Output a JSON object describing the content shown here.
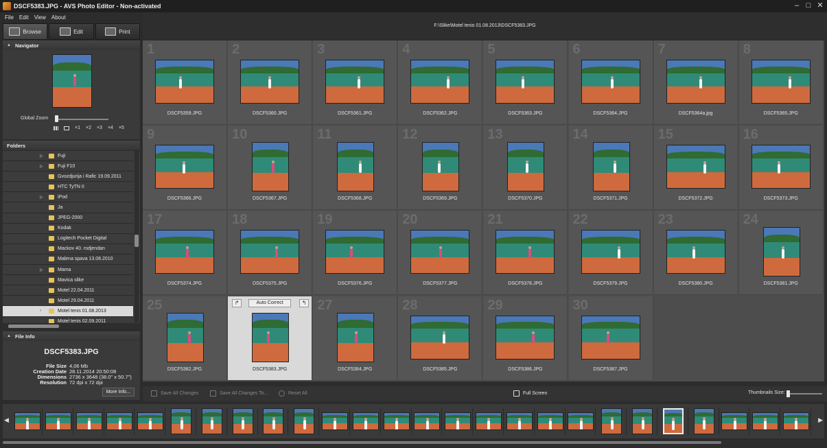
{
  "window": {
    "title": "DSCF5383.JPG - AVS Photo Editor - Non-activated",
    "controls": [
      "minimize-icon",
      "maximize-icon",
      "close-icon"
    ]
  },
  "menu": [
    "File",
    "Edit",
    "View",
    "About"
  ],
  "mode_tabs": [
    {
      "label": "Browse",
      "icon": "browse-icon",
      "active": true
    },
    {
      "label": "Edit",
      "icon": "edit-icon",
      "active": false
    },
    {
      "label": "Print",
      "icon": "print-icon",
      "active": false
    }
  ],
  "navigator": {
    "title": "Navigator",
    "zoom_label": "Global Zoom",
    "zoom_levels": [
      "×1",
      "×2",
      "×3",
      "×4",
      "×5"
    ]
  },
  "folders": {
    "title": "Folders",
    "items": [
      {
        "label": "Fuji",
        "expandable": true,
        "selected": false
      },
      {
        "label": "Fuji F10",
        "expandable": true,
        "selected": false
      },
      {
        "label": "Gvozdjurija i Rafic 19.09.2011",
        "expandable": false,
        "selected": false
      },
      {
        "label": "HTC TyTN II",
        "expandable": false,
        "selected": false
      },
      {
        "label": "iPod",
        "expandable": true,
        "selected": false
      },
      {
        "label": "Ja",
        "expandable": false,
        "selected": false
      },
      {
        "label": "JPEG-2000",
        "expandable": false,
        "selected": false
      },
      {
        "label": "Kodak",
        "expandable": false,
        "selected": false
      },
      {
        "label": "Logitech Pocket Digital",
        "expandable": false,
        "selected": false
      },
      {
        "label": "Mackov 40. rodjendan",
        "expandable": false,
        "selected": false
      },
      {
        "label": "Malena spava 13.08.2010",
        "expandable": false,
        "selected": false
      },
      {
        "label": "Mama",
        "expandable": true,
        "selected": false
      },
      {
        "label": "Mavica slike",
        "expandable": false,
        "selected": false
      },
      {
        "label": "Motel 22.04.2011",
        "expandable": false,
        "selected": false
      },
      {
        "label": "Motel 29.04.2011",
        "expandable": false,
        "selected": false
      },
      {
        "label": "Motel tenis 01.08.2013",
        "expandable": true,
        "selected": true
      },
      {
        "label": "Motel tenis 02.09.2011",
        "expandable": false,
        "selected": false
      }
    ]
  },
  "file_info": {
    "title": "File Info",
    "name": "DSCF5383.JPG",
    "rows": [
      {
        "key": "File Size",
        "value": "4,06 Mb"
      },
      {
        "key": "Creation Date",
        "value": "28.11.2014  20:50:08"
      },
      {
        "key": "Dimensions",
        "value": "2736 x 3648 (38.0\" x 50.7\")"
      },
      {
        "key": "Resolution",
        "value": "72 dpi x 72 dpi"
      }
    ],
    "more_button": "More Info..."
  },
  "path": "F:\\Slike\\Motel tenis 01.08.2013\\DSCF5383.JPG",
  "thumbnails": [
    {
      "n": "1",
      "name": "DSCF5359.JPG",
      "portrait": false
    },
    {
      "n": "2",
      "name": "DSCF5360.JPG",
      "portrait": false
    },
    {
      "n": "3",
      "name": "DSCF5361.JPG",
      "portrait": false
    },
    {
      "n": "4",
      "name": "DSCF5362.JPG",
      "portrait": false
    },
    {
      "n": "5",
      "name": "DSCF5363.JPG",
      "portrait": false
    },
    {
      "n": "6",
      "name": "DSCF5364.JPG",
      "portrait": false
    },
    {
      "n": "7",
      "name": "DSCF5364a.jpg",
      "portrait": false
    },
    {
      "n": "8",
      "name": "DSCF5365.JPG",
      "portrait": false
    },
    {
      "n": "9",
      "name": "DSCF5366.JPG",
      "portrait": false
    },
    {
      "n": "10",
      "name": "DSCF5367.JPG",
      "portrait": true
    },
    {
      "n": "11",
      "name": "DSCF5368.JPG",
      "portrait": true
    },
    {
      "n": "12",
      "name": "DSCF5369.JPG",
      "portrait": true
    },
    {
      "n": "13",
      "name": "DSCF5370.JPG",
      "portrait": true
    },
    {
      "n": "14",
      "name": "DSCF5371.JPG",
      "portrait": true
    },
    {
      "n": "15",
      "name": "DSCF5372.JPG",
      "portrait": false
    },
    {
      "n": "16",
      "name": "DSCF5373.JPG",
      "portrait": false
    },
    {
      "n": "17",
      "name": "DSCF5374.JPG",
      "portrait": false
    },
    {
      "n": "18",
      "name": "DSCF5375.JPG",
      "portrait": false
    },
    {
      "n": "19",
      "name": "DSCF5376.JPG",
      "portrait": false
    },
    {
      "n": "20",
      "name": "DSCF5377.JPG",
      "portrait": false
    },
    {
      "n": "21",
      "name": "DSCF5378.JPG",
      "portrait": false
    },
    {
      "n": "22",
      "name": "DSCF5379.JPG",
      "portrait": false
    },
    {
      "n": "23",
      "name": "DSCF5380.JPG",
      "portrait": false
    },
    {
      "n": "24",
      "name": "DSCF5381.JPG",
      "portrait": true
    },
    {
      "n": "25",
      "name": "DSCF5382.JPG",
      "portrait": true
    },
    {
      "n": "26",
      "name": "DSCF5383.JPG",
      "portrait": true,
      "selected": true
    },
    {
      "n": "27",
      "name": "DSCF5384.JPG",
      "portrait": true
    },
    {
      "n": "28",
      "name": "DSCF5385.JPG",
      "portrait": false
    },
    {
      "n": "29",
      "name": "DSCF5386.JPG",
      "portrait": false
    },
    {
      "n": "30",
      "name": "DSCF5387.JPG",
      "portrait": false
    }
  ],
  "selected_tools": {
    "auto_correct": "Auto Correct"
  },
  "toolbar": {
    "save_all": "Save All Changes",
    "save_all_to": "Save All Changes To...",
    "reset_all": "Reset All",
    "full_screen": "Full Screen",
    "thumb_size": "Thumbnails Size:"
  },
  "colors": {
    "background": "#2c2c2c",
    "grid": "#4d4d4d",
    "selected_cell": "#d9d9d9",
    "court": "#cf6a3e",
    "fence": "#2f8b78",
    "folder": "#e8c25a"
  }
}
